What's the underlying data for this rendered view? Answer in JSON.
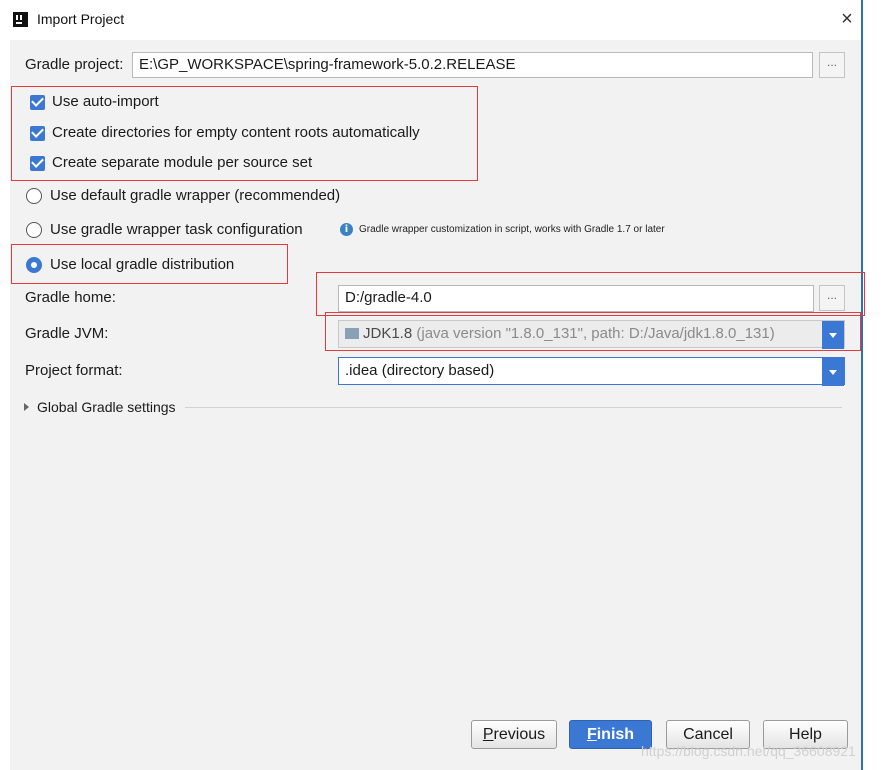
{
  "window": {
    "title": "Import Project",
    "close_glyph": "×"
  },
  "gradle_project": {
    "label": "Gradle project:",
    "value": "E:\\GP_WORKSPACE\\spring-framework-5.0.2.RELEASE",
    "browse_label": "..."
  },
  "checkboxes": [
    {
      "label": "Use auto-import",
      "checked": true
    },
    {
      "label": "Create directories for empty content roots automatically",
      "checked": true
    },
    {
      "label": "Create separate module per source set",
      "checked": true
    }
  ],
  "radios": [
    {
      "label": "Use default gradle wrapper (recommended)",
      "selected": false
    },
    {
      "label": "Use gradle wrapper task configuration",
      "selected": false
    },
    {
      "label": "Use local gradle distribution",
      "selected": true
    }
  ],
  "wrapper_info": "Gradle wrapper customization in script, works with Gradle 1.7 or later",
  "gradle_home": {
    "label": "Gradle home:",
    "value": "D:/gradle-4.0",
    "browse_label": "..."
  },
  "gradle_jvm": {
    "label": "Gradle JVM:",
    "value": "JDK1.8",
    "detail": " (java version \"1.8.0_131\", path: D:/Java/jdk1.8.0_131)"
  },
  "project_format": {
    "label": "Project format:",
    "value": ".idea (directory based)"
  },
  "global_settings": {
    "label": "Global Gradle settings"
  },
  "buttons": {
    "previous": {
      "mnemonic": "P",
      "rest": "revious"
    },
    "finish": {
      "mnemonic": "F",
      "rest": "inish"
    },
    "cancel": "Cancel",
    "help": "Help"
  },
  "watermark": "https://blog.csdn.net/qq_36608921",
  "colors": {
    "accent": "#3b78d4",
    "annotation": "#e23b3b",
    "dialog_bg": "#f2f2f2"
  }
}
